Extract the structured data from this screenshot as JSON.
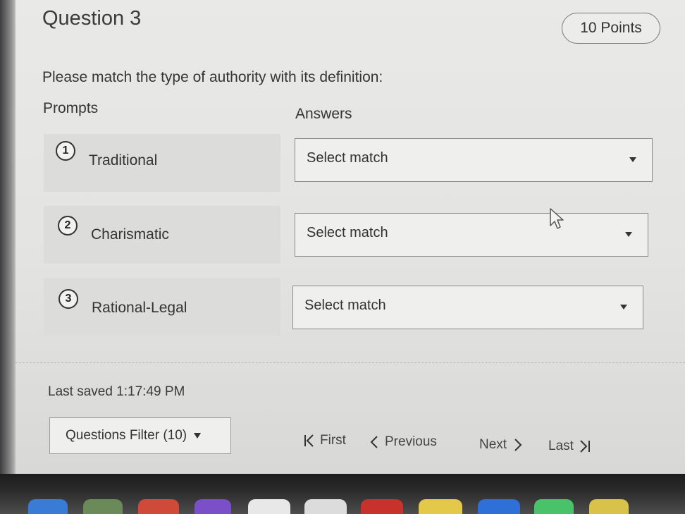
{
  "question": {
    "title": "Question 3",
    "points": "10 Points",
    "instructions": "Please match the type of authority with its definition:"
  },
  "columns": {
    "prompts": "Prompts",
    "answers": "Answers"
  },
  "prompts": [
    {
      "number": "1",
      "label": "Traditional"
    },
    {
      "number": "2",
      "label": "Charismatic"
    },
    {
      "number": "3",
      "label": "Rational-Legal"
    }
  ],
  "answers": [
    {
      "value": "Select match"
    },
    {
      "value": "Select match"
    },
    {
      "value": "Select match"
    }
  ],
  "footer": {
    "last_saved": "Last saved 1:17:49 PM",
    "filter_label": "Questions Filter (10)"
  },
  "navigation": {
    "first": "First",
    "previous": "Previous",
    "next": "Next",
    "last": "Last"
  },
  "colors": {
    "background": "#e6e6e4",
    "text": "#333333",
    "border": "#8a8a8a"
  }
}
